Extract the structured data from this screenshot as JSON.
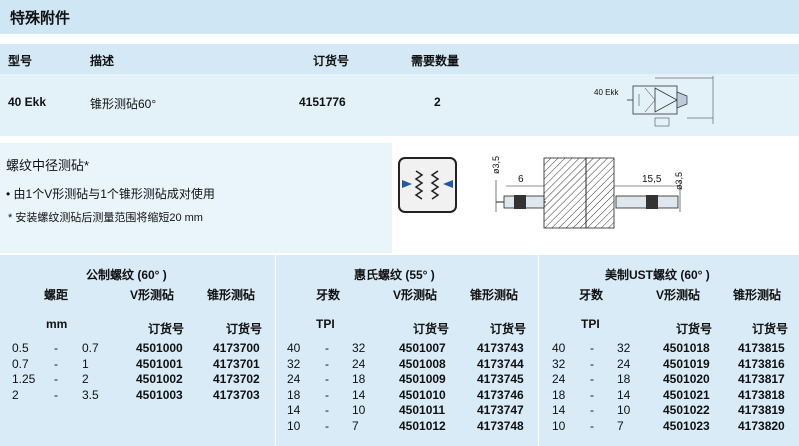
{
  "title": "特殊附件",
  "header": {
    "model": "型号",
    "desc": "描述",
    "order_no": "订货号",
    "qty": "需要数量"
  },
  "item": {
    "model": "40 Ekk",
    "desc": "锥形测砧60°",
    "order_no": "4151776",
    "qty": "2",
    "drawing_label": "40 Ekk"
  },
  "thread_anvil": {
    "title": "螺纹中径测砧*",
    "bullet": "• 由1个V形测砧与1个锥形测砧成对使用",
    "note": "*  安装螺纹测砧后测量范围将缩短20  mm",
    "dims": {
      "d1": "ø3,5",
      "w1": "6",
      "w2": "15,5",
      "d2": "ø3,5"
    }
  },
  "table": {
    "groups": [
      {
        "title": "公制螺纹 (60° )",
        "col1": "螺距",
        "col1_unit": "mm",
        "col2": "V形测砧",
        "col3": "锥形测砧",
        "order_label": "订货号",
        "order_label2": "订货号",
        "rows": [
          {
            "a": "0.5",
            "dash": "-",
            "b": "0.7",
            "v": "4501000",
            "c": "4173700"
          },
          {
            "a": "0.7",
            "dash": "-",
            "b": "1",
            "v": "4501001",
            "c": "4173701"
          },
          {
            "a": "1.25",
            "dash": "-",
            "b": "2",
            "v": "4501002",
            "c": "4173702"
          },
          {
            "a": "2",
            "dash": "-",
            "b": "3.5",
            "v": "4501003",
            "c": "4173703"
          }
        ]
      },
      {
        "title": "惠氏螺纹 (55° )",
        "col1": "牙数",
        "col1_unit": "TPI",
        "col2": "V形测砧",
        "col3": "锥形测砧",
        "order_label": "订货号",
        "order_label2": "订货号",
        "rows": [
          {
            "a": "40",
            "dash": "-",
            "b": "32",
            "v": "4501007",
            "c": "4173743"
          },
          {
            "a": "32",
            "dash": "-",
            "b": "24",
            "v": "4501008",
            "c": "4173744"
          },
          {
            "a": "24",
            "dash": "-",
            "b": "18",
            "v": "4501009",
            "c": "4173745"
          },
          {
            "a": "18",
            "dash": "-",
            "b": "14",
            "v": "4501010",
            "c": "4173746"
          },
          {
            "a": "14",
            "dash": "-",
            "b": "10",
            "v": "4501011",
            "c": "4173747"
          },
          {
            "a": "10",
            "dash": "-",
            "b": "7",
            "v": "4501012",
            "c": "4173748"
          }
        ]
      },
      {
        "title": "美制UST螺纹 (60° )",
        "col1": "牙数",
        "col1_unit": "TPI",
        "col2": "V形测砧",
        "col3": "锥形测砧",
        "order_label": "订货号",
        "order_label2": "订货号",
        "rows": [
          {
            "a": "40",
            "dash": "-",
            "b": "32",
            "v": "4501018",
            "c": "4173815"
          },
          {
            "a": "32",
            "dash": "-",
            "b": "24",
            "v": "4501019",
            "c": "4173816"
          },
          {
            "a": "24",
            "dash": "-",
            "b": "18",
            "v": "4501020",
            "c": "4173817"
          },
          {
            "a": "18",
            "dash": "-",
            "b": "14",
            "v": "4501021",
            "c": "4173818"
          },
          {
            "a": "14",
            "dash": "-",
            "b": "10",
            "v": "4501022",
            "c": "4173819"
          },
          {
            "a": "10",
            "dash": "-",
            "b": "7",
            "v": "4501023",
            "c": "4173820"
          }
        ]
      }
    ]
  }
}
